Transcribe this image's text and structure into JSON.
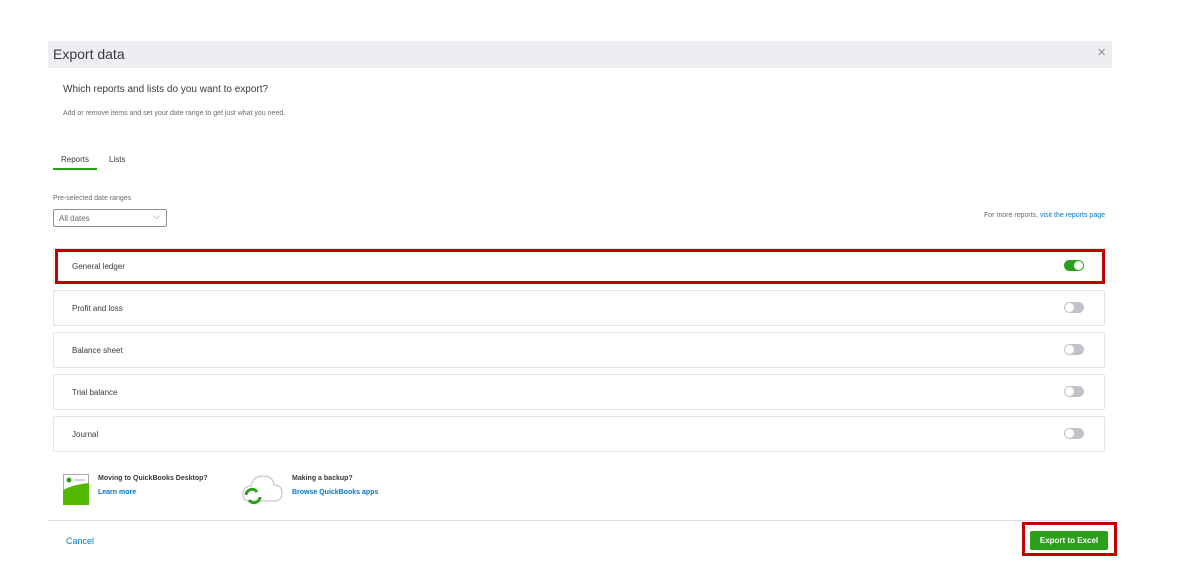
{
  "dialog": {
    "title": "Export data",
    "close_icon": "×"
  },
  "question": "Which reports and lists do you want to export?",
  "subtitle": "Add or remove items and set your date range to get just what you need.",
  "tabs": [
    {
      "label": "Reports",
      "active": true
    },
    {
      "label": "Lists",
      "active": false
    }
  ],
  "date_range": {
    "label": "Pre-selected date ranges",
    "value": "All dates",
    "chevron": "⌵"
  },
  "more_reports": {
    "text": "For more reports, ",
    "link": "visit the reports page"
  },
  "reports": [
    {
      "name": "General ledger",
      "enabled": true
    },
    {
      "name": "Profit and loss",
      "enabled": false
    },
    {
      "name": "Balance sheet",
      "enabled": false
    },
    {
      "name": "Trial balance",
      "enabled": false
    },
    {
      "name": "Journal",
      "enabled": false
    }
  ],
  "promos": [
    {
      "title": "Moving to QuickBooks Desktop?",
      "link": "Learn more"
    },
    {
      "title": "Making a backup?",
      "link": "Browse QuickBooks apps"
    }
  ],
  "footer": {
    "cancel": "Cancel",
    "export": "Export to Excel"
  },
  "colors": {
    "accent": "#2ca01c",
    "link": "#0077c5",
    "highlight": "#c00000"
  }
}
